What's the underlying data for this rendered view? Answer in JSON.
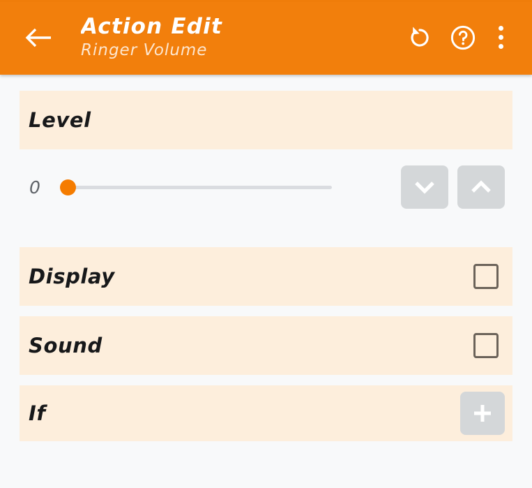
{
  "header": {
    "back_icon": "arrow-left-icon",
    "title": "Action Edit",
    "subtitle": "Ringer Volume",
    "undo_icon": "undo-rotate-left-icon",
    "help_icon": "help-circle-icon",
    "overflow_icon": "more-vertical-icon",
    "background_color": "#f27f0c",
    "title_color": "#ffffff",
    "subtitle_color": "#fde6cf"
  },
  "sections": {
    "level": {
      "label": "Level",
      "slider": {
        "value": "0",
        "min": 0,
        "max": 100,
        "current": 0,
        "thumb_color": "#f57c00",
        "track_color": "#dadce0"
      },
      "decrement_button": {
        "icon": "chevron-down-icon",
        "label": ""
      },
      "increment_button": {
        "icon": "chevron-up-icon",
        "label": ""
      }
    },
    "display": {
      "label": "Display",
      "checkbox_checked": false,
      "checkbox_icon": "checkbox-unchecked-icon"
    },
    "sound": {
      "label": "Sound",
      "checkbox_checked": false,
      "checkbox_icon": "checkbox-unchecked-icon"
    },
    "if": {
      "label": "If",
      "add_button_icon": "plus-icon"
    }
  },
  "theme": {
    "page_background": "#f8f9fa",
    "row_background": "#fdeedc",
    "accent": "#f57c00",
    "button_gray": "#d4d7d9",
    "checkbox_border": "#6b6259",
    "label_color": "#17181a",
    "value_color": "#5f6368"
  }
}
